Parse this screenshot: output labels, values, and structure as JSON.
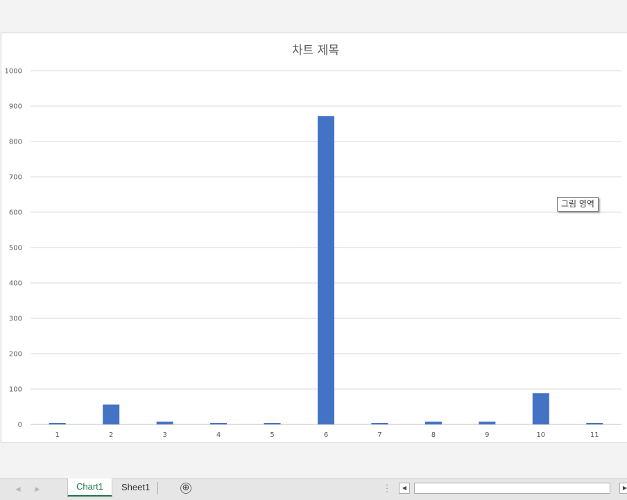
{
  "chart_data": {
    "type": "bar",
    "title": "차트 제목",
    "categories": [
      "1",
      "2",
      "3",
      "4",
      "5",
      "6",
      "7",
      "8",
      "9",
      "10",
      "11"
    ],
    "values": [
      4,
      56,
      8,
      4,
      4,
      872,
      4,
      8,
      8,
      88,
      4
    ],
    "ylim": [
      0,
      1000
    ],
    "yticks": [
      0,
      100,
      200,
      300,
      400,
      500,
      600,
      700,
      800,
      900,
      1000
    ],
    "grid": true,
    "legend": "none",
    "color": "#4472c4"
  },
  "tooltip": {
    "text": "그림 영역"
  },
  "sheet_tabs": {
    "items": [
      {
        "label": "Chart1",
        "active": true
      },
      {
        "label": "Sheet1",
        "active": false
      }
    ],
    "add_label": "⊕"
  },
  "colors": {
    "accent": "#217346",
    "bar": "#4472c4"
  }
}
